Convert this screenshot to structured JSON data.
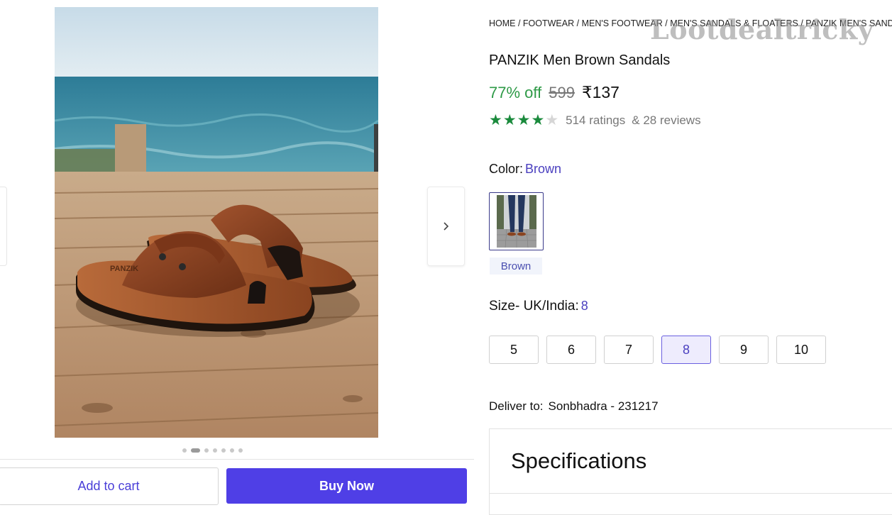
{
  "breadcrumb": [
    "HOME",
    "FOOTWEAR",
    "MEN'S FOOTWEAR",
    "MEN'S SANDALS & FLOATERS",
    "PANZIK MEN'S SANDALS"
  ],
  "watermark": "Lootdealtricky",
  "product": {
    "title": "PANZIK Men Brown Sandals",
    "discount": "77% off",
    "mrp": "599",
    "price": "₹137",
    "rating_value": 4,
    "rating_max": 5,
    "ratings_text": "514 ratings",
    "reviews_text": "& 28 reviews",
    "image_icon": "sandal-photo",
    "image_brand_print": "PANZIK"
  },
  "gallery": {
    "dot_count": 7,
    "active_dot": 1
  },
  "color": {
    "label": "Color:",
    "value": "Brown",
    "swatch_label": "Brown"
  },
  "size": {
    "label": "Size- UK/India:",
    "value": "8",
    "options": [
      "5",
      "6",
      "7",
      "8",
      "9",
      "10"
    ],
    "selected": "8"
  },
  "delivery": {
    "label": "Deliver to:",
    "location": "Sonbhadra - 231217"
  },
  "specifications": {
    "title": "Specifications"
  },
  "actions": {
    "add_to_cart": "Add to cart",
    "buy_now": "Buy Now"
  },
  "icons": {
    "next": "chevron-right-icon",
    "star": "star-icon"
  },
  "colors": {
    "accent": "#4f3fe6",
    "discount": "#2e9a47",
    "star": "#1a8a3c"
  }
}
